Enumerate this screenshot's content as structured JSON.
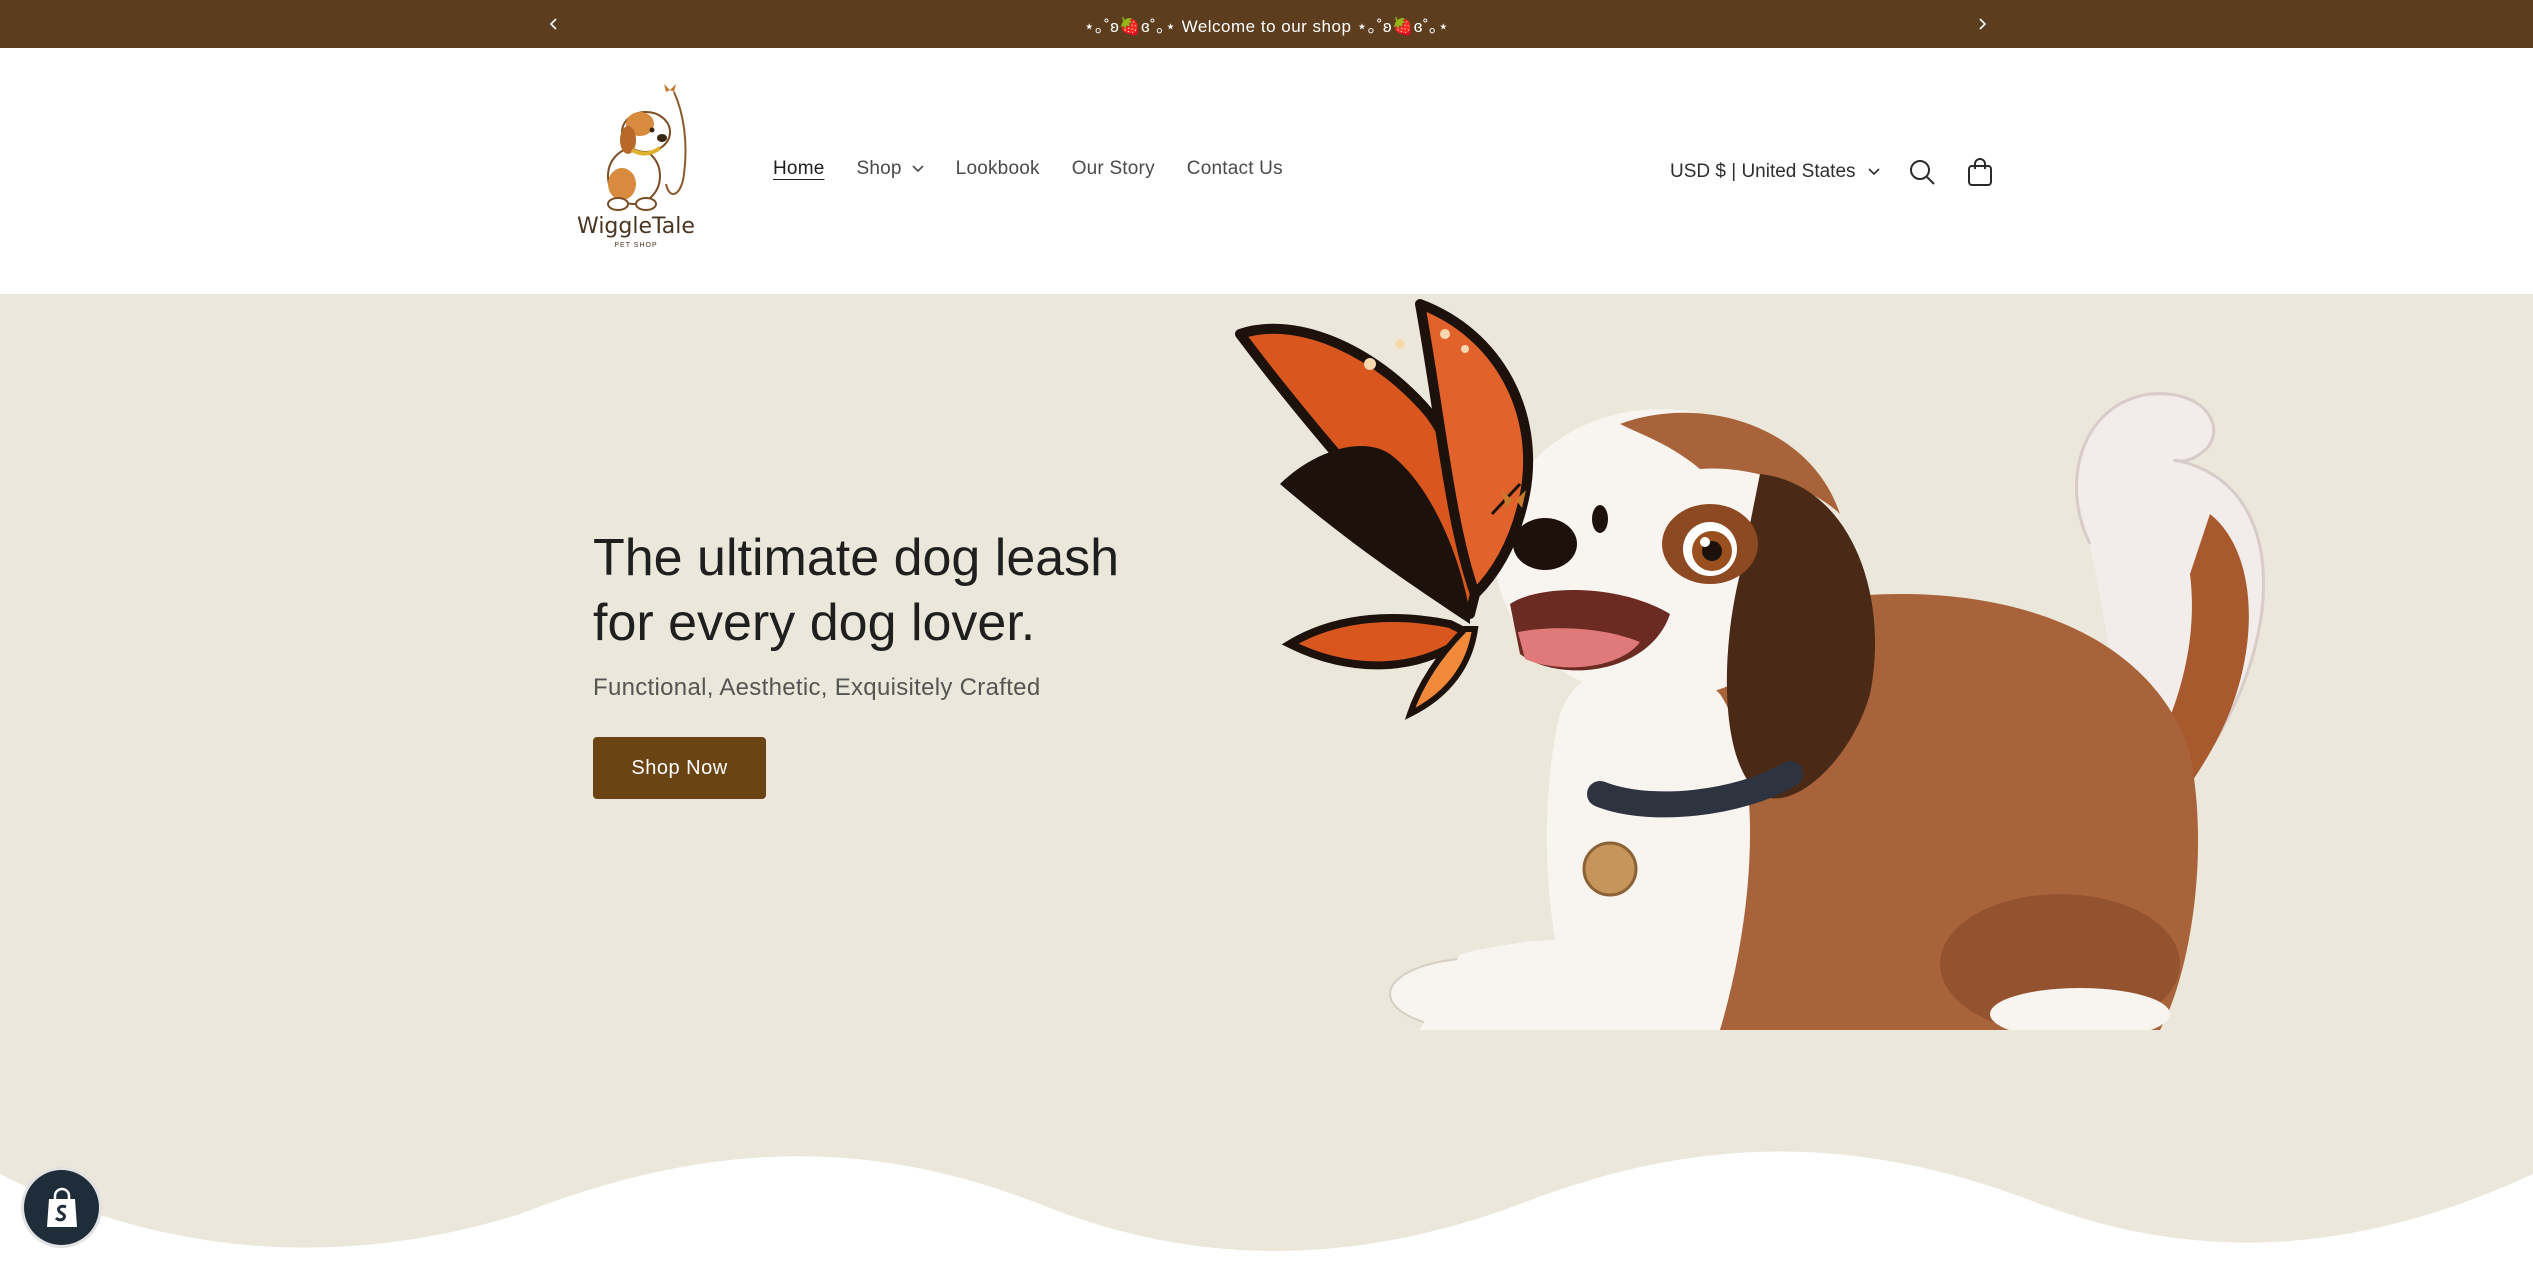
{
  "announcement": {
    "message": "⋆｡˚ʚ🍓ɞ˚｡⋆ Welcome to our shop ⋆｡˚ʚ🍓ɞ˚｡⋆",
    "prev_icon": "chevron-left-icon",
    "next_icon": "chevron-right-icon"
  },
  "header": {
    "logo": {
      "name": "WiggleTale",
      "tagline": "PET SHOP"
    },
    "nav": [
      {
        "label": "Home",
        "active": true
      },
      {
        "label": "Shop",
        "has_dropdown": true
      },
      {
        "label": "Lookbook"
      },
      {
        "label": "Our Story"
      },
      {
        "label": "Contact Us"
      }
    ],
    "currency": {
      "label": "USD $ | United States"
    },
    "icons": {
      "search": "search-icon",
      "cart": "cart-icon"
    }
  },
  "hero": {
    "title": "The ultimate dog leash for every dog lover.",
    "subtitle": "Functional, Aesthetic, Exquisitely Crafted",
    "cta_label": "Shop Now",
    "image": "dog-with-butterfly-illustration"
  },
  "colors": {
    "announcement_bg": "#5c3d1e",
    "hero_bg": "#ebe7da",
    "cta_bg": "#6b4414",
    "text_dark": "#1f1f1f"
  },
  "widgets": {
    "shopify_badge": "shopify-bag-icon"
  }
}
